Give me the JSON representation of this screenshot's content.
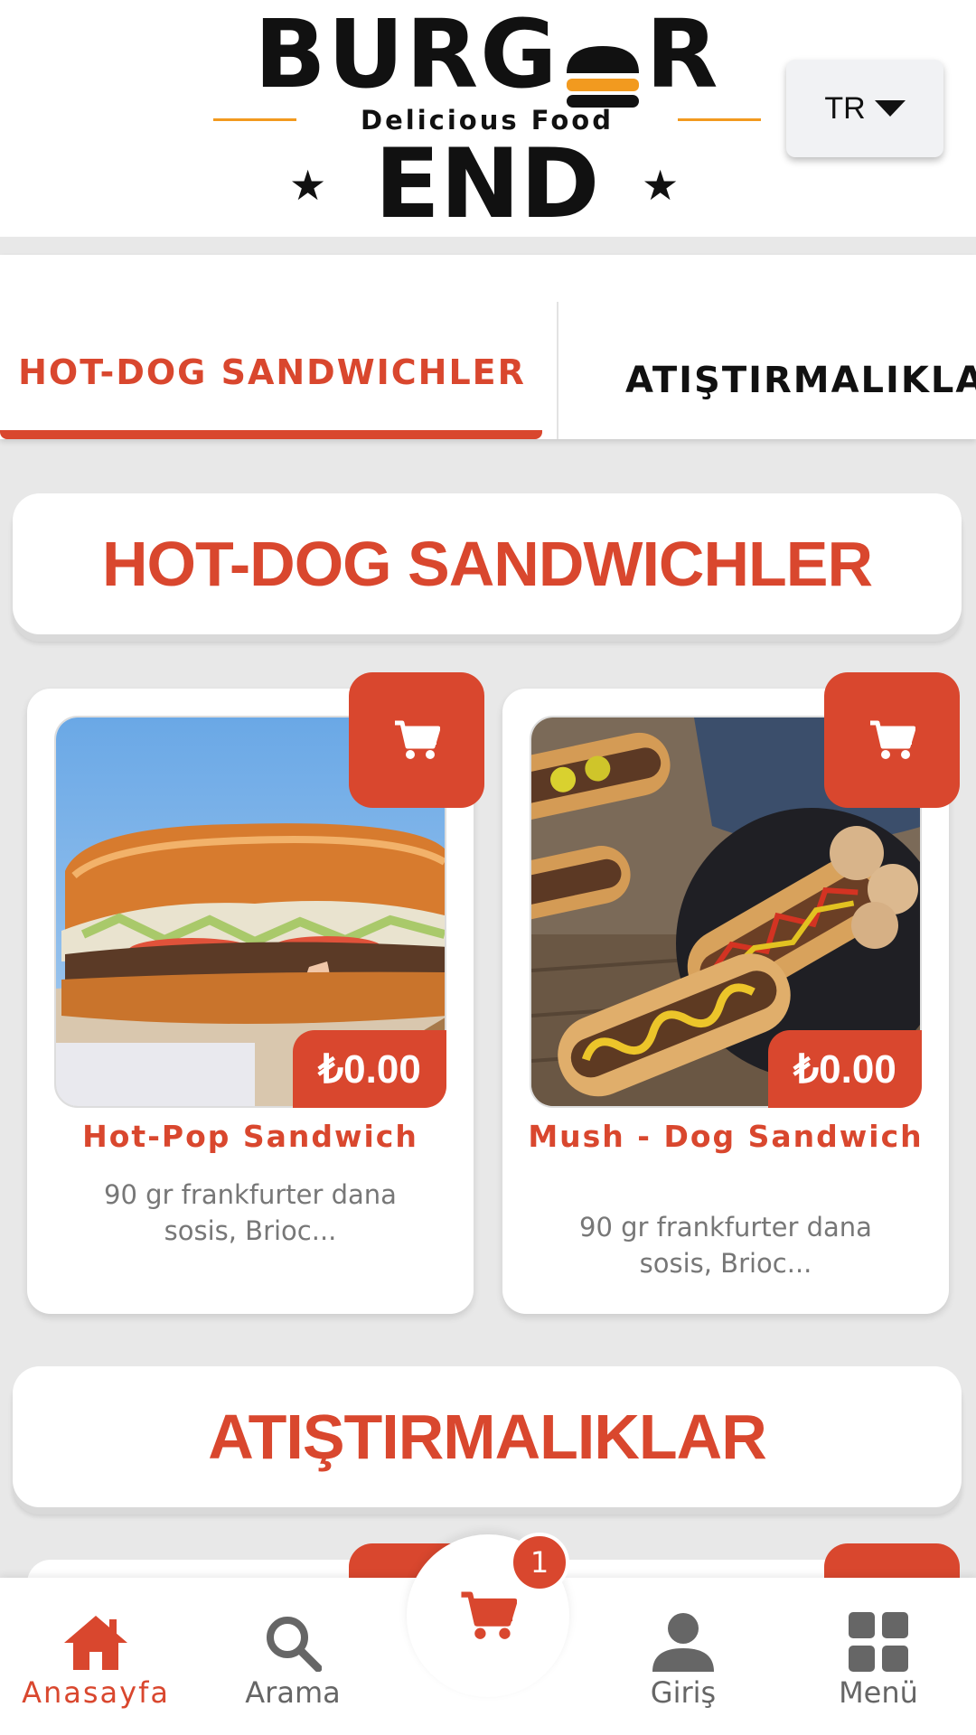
{
  "header": {
    "logo": {
      "top_text": "BURGER",
      "tagline": "Delicious Food",
      "bottom_text": "END"
    },
    "language": "TR"
  },
  "tabs": [
    {
      "label": "HOT-DOG SANDWICHLER",
      "active": true
    },
    {
      "label": "ATIŞTIRMALIKLAR",
      "active": false
    }
  ],
  "sections": [
    {
      "title": "HOT-DOG SANDWICHLER"
    },
    {
      "title": "ATIŞTIRMALIKLAR"
    }
  ],
  "products": [
    {
      "name": "Hot-Pop Sandwich",
      "description": "90 gr frankfurter dana sosis, Brioc...",
      "price": "₺0.00"
    },
    {
      "name": "Mush - Dog Sandwich",
      "description": "90 gr frankfurter dana sosis, Brioc...",
      "price": "₺0.00"
    }
  ],
  "bottom_nav": {
    "items": [
      {
        "label": "Anasayfa",
        "icon": "home-icon",
        "active": true
      },
      {
        "label": "Arama",
        "icon": "search-icon",
        "active": false
      },
      {
        "label": "Giriş",
        "icon": "user-icon",
        "active": false
      },
      {
        "label": "Menü",
        "icon": "grid-icon",
        "active": false
      }
    ],
    "cart_count": "1"
  },
  "colors": {
    "accent": "#d9472e",
    "background": "#e8e8e8",
    "logo_accent": "#f29a1f"
  }
}
